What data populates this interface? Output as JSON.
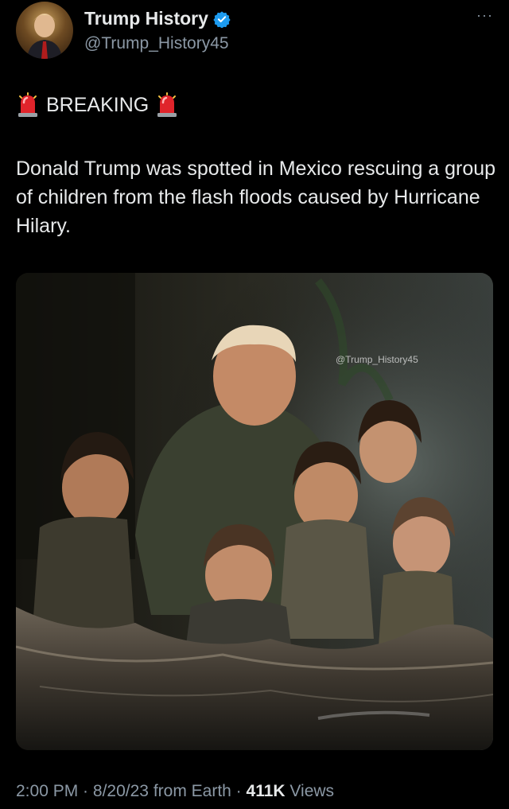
{
  "author": {
    "display_name": "Trump History",
    "handle": "@Trump_History45",
    "verified": true,
    "avatar_icon": "avatar-portrait"
  },
  "more_icon": "ellipsis-icon",
  "tweet": {
    "breaking_label": "BREAKING",
    "siren_icon": "police-siren-emoji",
    "text": "Donald Trump was spotted in Mexico rescuing a group of children from the flash floods caused by Hurricane Hilary."
  },
  "media": {
    "watermark": "@Trump_History45"
  },
  "meta": {
    "time": "2:00 PM",
    "separator": " · ",
    "date": "8/20/23",
    "source": "from Earth",
    "views_count": "411K",
    "views_label": "Views"
  },
  "colors": {
    "background": "#000000",
    "primary_text": "#e7e9ea",
    "secondary_text": "#8b98a5",
    "verified_blue": "#1d9bf0"
  }
}
